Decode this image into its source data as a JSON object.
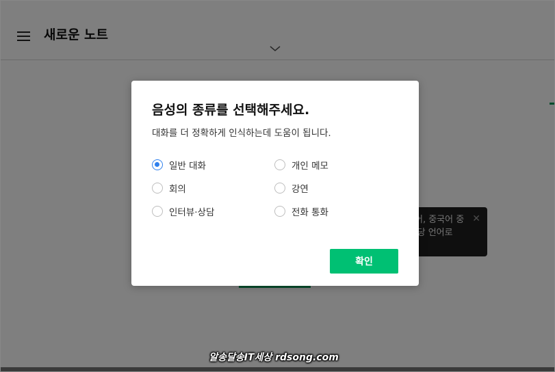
{
  "header": {
    "title": "새로운 노트",
    "menu_icon": "hamburger-icon",
    "expand_icon": "chevron-down-icon"
  },
  "tooltip": {
    "line1": "어, 중국어 중",
    "line2": "l당 언어로",
    "close_icon": "close-icon"
  },
  "dialog": {
    "title": "음성의 종류를 선택해주세요.",
    "subtitle": "대화를 더 정확하게 인식하는데 도움이 됩니다.",
    "options": [
      {
        "label": "일반 대화",
        "selected": true
      },
      {
        "label": "개인 메모",
        "selected": false
      },
      {
        "label": "회의",
        "selected": false
      },
      {
        "label": "강연",
        "selected": false
      },
      {
        "label": "인터뷰·상담",
        "selected": false
      },
      {
        "label": "전화 통화",
        "selected": false
      }
    ],
    "confirm_label": "확인"
  },
  "watermark": "알송달송IT세상 rdsong.com",
  "colors": {
    "accent": "#00c073",
    "radio_selected": "#2f80ed",
    "tooltip_bg": "#1e1e1e"
  }
}
